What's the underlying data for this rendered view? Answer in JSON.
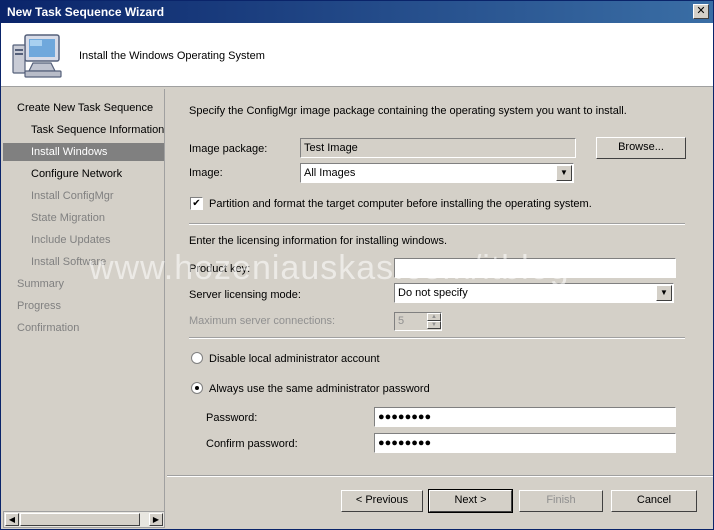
{
  "window": {
    "title": "New Task Sequence Wizard",
    "close_glyph": "✕"
  },
  "header": {
    "heading": "Install the Windows Operating System",
    "icon": "computer-icon"
  },
  "nav": {
    "items": [
      {
        "label": "Create New Task Sequence",
        "state": "normal"
      },
      {
        "label": "Task Sequence Information",
        "state": "normal"
      },
      {
        "label": "Install Windows",
        "state": "active"
      },
      {
        "label": "Configure Network",
        "state": "normal"
      },
      {
        "label": "Install ConfigMgr",
        "state": "dim"
      },
      {
        "label": "State Migration",
        "state": "dim"
      },
      {
        "label": "Include Updates",
        "state": "dim"
      },
      {
        "label": "Install Software",
        "state": "dim"
      },
      {
        "label": "Summary",
        "state": "dim"
      },
      {
        "label": "Progress",
        "state": "dim"
      },
      {
        "label": "Confirmation",
        "state": "dim"
      }
    ]
  },
  "content": {
    "instruction": "Specify the ConfigMgr image package containing the operating system you want to install.",
    "image_package": {
      "label": "Image package:",
      "value": "Test Image",
      "browse_label": "Browse..."
    },
    "image": {
      "label": "Image:",
      "value": "All Images"
    },
    "partition_checkbox": {
      "label": "Partition and format the target computer before installing the operating system.",
      "checked": true,
      "mark": "✔"
    },
    "licensing_heading": "Enter the licensing information for installing windows.",
    "product_key": {
      "label": "Product key:",
      "value": ""
    },
    "server_licensing_mode": {
      "label": "Server licensing mode:",
      "value": "Do not specify"
    },
    "max_connections": {
      "label": "Maximum server connections:",
      "value": "5"
    },
    "disable_admin": {
      "label": "Disable local administrator account",
      "selected": false
    },
    "same_password": {
      "label": "Always use the same administrator password",
      "selected": true
    },
    "password": {
      "label": "Password:",
      "value": "●●●●●●●●"
    },
    "confirm_password": {
      "label": "Confirm password:",
      "value": "●●●●●●●●"
    }
  },
  "watermark": "www.hozeniauskas.com/itblog",
  "footer": {
    "previous_label": "< Previous",
    "next_label": "Next >",
    "finish_label": "Finish",
    "cancel_label": "Cancel"
  }
}
